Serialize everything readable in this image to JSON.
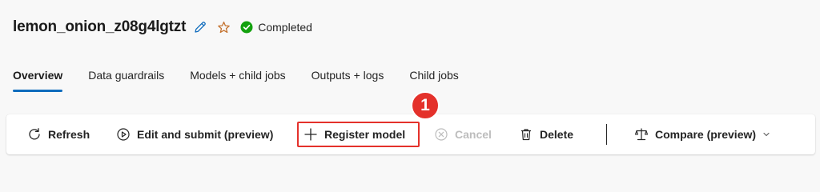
{
  "header": {
    "job_name": "lemon_onion_z08g4lgtzt",
    "status": "Completed"
  },
  "tabs": [
    {
      "label": "Overview"
    },
    {
      "label": "Data guardrails"
    },
    {
      "label": "Models + child jobs"
    },
    {
      "label": "Outputs + logs"
    },
    {
      "label": "Child jobs"
    }
  ],
  "callout": {
    "number": "1"
  },
  "toolbar": {
    "refresh": "Refresh",
    "edit_submit": "Edit and submit (preview)",
    "register_model": "Register model",
    "cancel": "Cancel",
    "delete": "Delete",
    "compare": "Compare (preview)"
  },
  "colors": {
    "accent": "#0f6cbd",
    "success": "#13a10e",
    "highlight": "#e4312b",
    "star": "#c4722f"
  },
  "icons": [
    "edit-pencil-icon",
    "star-icon",
    "checkmark-circle-icon",
    "refresh-icon",
    "play-circle-icon",
    "add-icon",
    "cancel-circle-icon",
    "trash-icon",
    "scale-icon",
    "chevron-down-icon"
  ]
}
